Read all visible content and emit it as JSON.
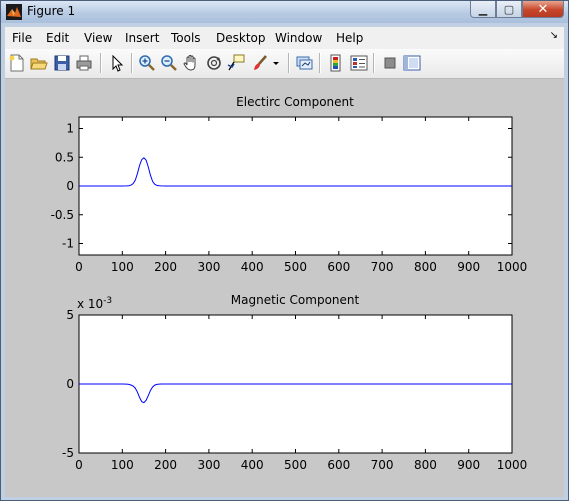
{
  "window": {
    "title": "Figure 1",
    "controls": {
      "minimize": "▁",
      "maximize": "▢",
      "close": "✕"
    }
  },
  "menubar": {
    "items": [
      "File",
      "Edit",
      "View",
      "Insert",
      "Tools",
      "Desktop",
      "Window",
      "Help"
    ],
    "dock_glyph": "↘"
  },
  "toolbar": {
    "icons": [
      "new-figure-icon",
      "open-file-icon",
      "save-icon",
      "print-icon",
      "edit-plot-arrow-icon",
      "zoom-in-icon",
      "zoom-out-icon",
      "pan-hand-icon",
      "rotate-3d-icon",
      "data-cursor-icon",
      "brush-icon",
      "brush-dropdown-icon",
      "link-plot-icon",
      "insert-colorbar-icon",
      "insert-legend-icon",
      "hide-plot-tools-icon",
      "show-plot-tools-icon"
    ]
  },
  "colors": {
    "line": "#0000ff",
    "figure_bg": "#c8c8c8",
    "axes_bg": "#ffffff"
  },
  "chart_data": [
    {
      "type": "line",
      "title": "Electirc Component",
      "xlabel": "",
      "ylabel": "",
      "xlim": [
        0,
        1000
      ],
      "ylim": [
        -1.2,
        1.2
      ],
      "xticks": [
        "0",
        "100",
        "200",
        "300",
        "400",
        "500",
        "600",
        "700",
        "800",
        "900",
        "1000"
      ],
      "yticks": [
        "1",
        "0.5",
        "0",
        "-0.5",
        "-1"
      ],
      "ytick_values": [
        1,
        0.5,
        0,
        -0.5,
        -1
      ],
      "exponent_label": "",
      "grid": false,
      "series": [
        {
          "color": "#0000ff",
          "x": [
            0,
            100,
            110,
            115,
            120,
            125,
            130,
            135,
            140,
            145,
            150,
            155,
            160,
            165,
            170,
            175,
            180,
            185,
            190,
            200,
            300,
            400,
            500,
            600,
            700,
            800,
            900,
            1000
          ],
          "y": [
            0,
            0,
            0.002,
            0.006,
            0.015,
            0.04,
            0.1,
            0.22,
            0.36,
            0.46,
            0.49,
            0.45,
            0.33,
            0.19,
            0.08,
            0.03,
            0.01,
            0.003,
            0.001,
            0,
            0,
            0,
            0,
            0,
            0,
            0,
            0,
            0
          ]
        }
      ]
    },
    {
      "type": "line",
      "title": "Magnetic Component",
      "xlabel": "",
      "ylabel": "",
      "xlim": [
        0,
        1000
      ],
      "ylim": [
        -0.005,
        0.005
      ],
      "xticks": [
        "0",
        "100",
        "200",
        "300",
        "400",
        "500",
        "600",
        "700",
        "800",
        "900",
        "1000"
      ],
      "yticks": [
        "5",
        "0",
        "-5"
      ],
      "ytick_values": [
        0.005,
        0,
        -0.005
      ],
      "exponent_label": "x 10",
      "exponent_power": "-3",
      "grid": false,
      "series": [
        {
          "color": "#0000ff",
          "x": [
            0,
            100,
            110,
            115,
            120,
            125,
            130,
            135,
            140,
            145,
            150,
            155,
            160,
            165,
            170,
            175,
            180,
            185,
            190,
            200,
            300,
            400,
            500,
            600,
            700,
            800,
            900,
            1000
          ],
          "y": [
            0,
            0,
            -1e-05,
            -3e-05,
            -7e-05,
            -0.00015,
            -0.0003,
            -0.0006,
            -0.00098,
            -0.00128,
            -0.00135,
            -0.00118,
            -0.00084,
            -0.00048,
            -0.00022,
            -8e-05,
            -3e-05,
            -1e-05,
            0,
            0,
            0,
            0,
            0,
            0,
            0,
            0,
            0,
            0
          ]
        }
      ]
    }
  ]
}
